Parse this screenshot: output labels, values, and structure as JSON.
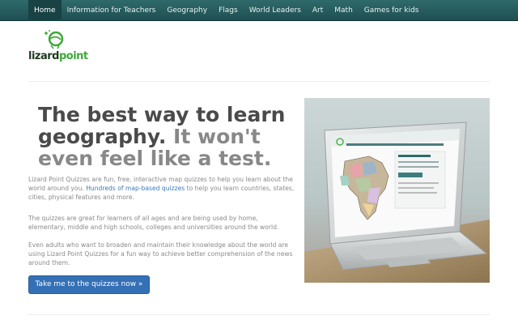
{
  "nav": {
    "items": [
      {
        "label": "Home",
        "active": true
      },
      {
        "label": "Information for Teachers",
        "active": false
      },
      {
        "label": "Geography",
        "active": false
      },
      {
        "label": "Flags",
        "active": false
      },
      {
        "label": "World Leaders",
        "active": false
      },
      {
        "label": "Art",
        "active": false
      },
      {
        "label": "Math",
        "active": false
      },
      {
        "label": "Games for kids",
        "active": false
      }
    ]
  },
  "logo": {
    "word1": "lizard",
    "word2": "point"
  },
  "hero": {
    "headline_bold": "The best way to learn geography.",
    "headline_light": " It won't even feel like a test.",
    "p1_before": "Lizard Point Quizzes are fun, free, interactive map quizzes to help you learn about the world around you. ",
    "p1_link": "Hundreds of map-based quizzes",
    "p1_after": " to help you learn countries, states, cities, physical features and more.",
    "p2": "The quizzes are great for learners of all ages and are being used by home, elementary, middle and high schools, colleges and universities around the world.",
    "p3": "Even adults who want to broaden and maintain their knowledge about the world are using Lizard Point Quizzes for a fun way to achieve better comprehension of the news around them.",
    "cta": "Take me to the quizzes now »"
  },
  "colors": {
    "nav_bg": "#245a5c",
    "accent": "#3470b5",
    "link": "#3d7ab8",
    "logo_green": "#3fa83a"
  },
  "icons": {
    "logo": "lizard-logo-icon"
  }
}
